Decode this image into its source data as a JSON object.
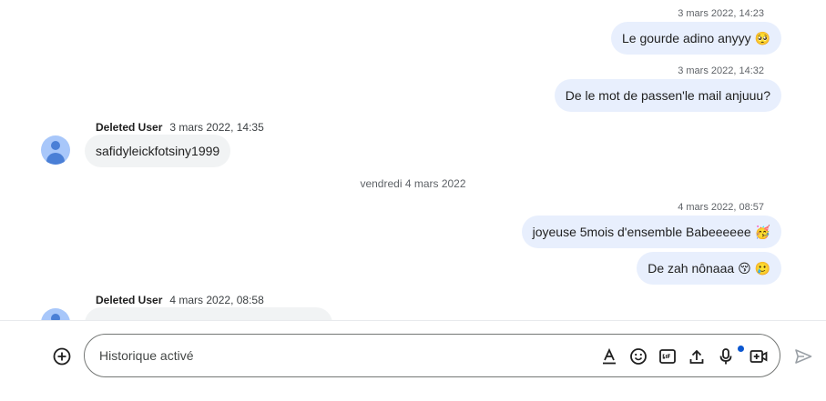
{
  "messages": {
    "m1": {
      "time": "3 mars 2022, 14:23",
      "text": "Le gourde adino anyyy",
      "emoji": "🥺"
    },
    "m2": {
      "time": "3 mars 2022, 14:32",
      "text": "De le mot de passen'le mail anjuuu?"
    },
    "m3": {
      "sender": "Deleted User",
      "time": "3 mars 2022, 14:35",
      "text": "safidyleickfotsiny1999"
    },
    "date_separator": "vendredi 4 mars 2022",
    "m4": {
      "time": "4 mars 2022, 08:57",
      "text": "joyeuse 5mois d'ensemble Babeeeeee",
      "emoji": "🥳"
    },
    "m5": {
      "text": "De zah nônaaa",
      "emoji1": "😚",
      "emoji2": "🥲"
    },
    "m6": {
      "sender": "Deleted User",
      "time": "4 mars 2022, 08:58"
    }
  },
  "composer": {
    "placeholder": "Historique activé"
  },
  "icons": {
    "add": "add-circle-icon",
    "format": "text-format-icon",
    "emoji": "emoji-icon",
    "gif": "gif-icon",
    "upload": "upload-icon",
    "mic": "microphone-icon",
    "video": "video-add-icon",
    "send": "send-icon"
  },
  "colors": {
    "outgoing_bubble": "#e8effd",
    "incoming_bubble": "#f1f3f4",
    "avatar": "#a8c7fa",
    "accent": "#0b57d0"
  }
}
